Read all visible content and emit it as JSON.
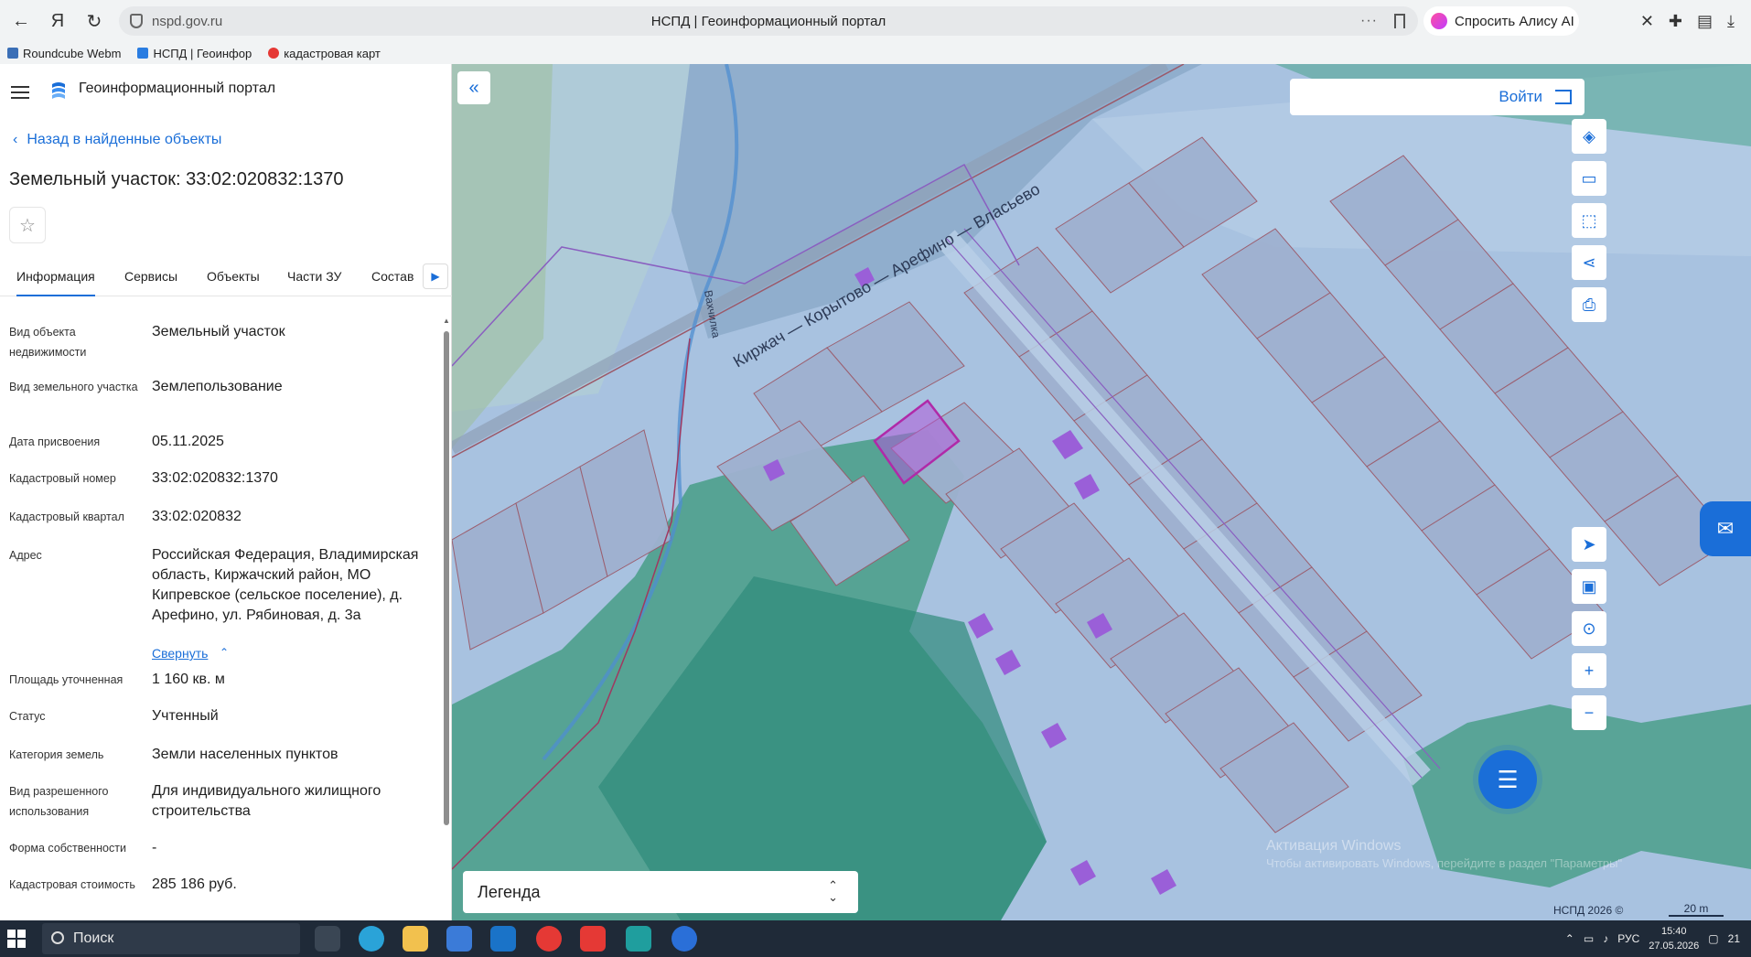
{
  "browser": {
    "url": "nspd.gov.ru",
    "tab_title": "НСПД | Геоинформационный портал",
    "alice_label": "Спросить Алису AI",
    "bookmarks": [
      {
        "label": "Roundcube Webm"
      },
      {
        "label": "НСПД | Геоинфор"
      },
      {
        "label": "кадастровая карт"
      }
    ]
  },
  "app": {
    "title": "Геоинформационный портал",
    "back_link": "Назад в найденные объекты",
    "parcel_title": "Земельный участок: 33:02:020832:1370",
    "tabs": [
      "Информация",
      "Сервисы",
      "Объекты",
      "Части ЗУ",
      "Состав"
    ],
    "collapse_label": "Свернуть",
    "fields": [
      {
        "label": "Вид объекта недвижимости",
        "value": "Земельный участок"
      },
      {
        "label": "Вид земельного участка",
        "value": "Землепользование"
      },
      {
        "label": "Дата присвоения",
        "value": "05.11.2025"
      },
      {
        "label": "Кадастровый номер",
        "value": "33:02:020832:1370"
      },
      {
        "label": "Кадастровый квартал",
        "value": "33:02:020832"
      },
      {
        "label": "Адрес",
        "value": "Российская Федерация, Владимирская область, Киржачский район, МО Кипревское (сельское поселение), д. Арефино, ул. Рябиновая, д. 3а"
      },
      {
        "label": "Площадь уточненная",
        "value": "1 160 кв. м"
      },
      {
        "label": "Статус",
        "value": "Учтенный"
      },
      {
        "label": "Категория земель",
        "value": "Земли населенных пунктов"
      },
      {
        "label": "Вид разрешенного использования",
        "value": "Для индивидуального жилищного строительства"
      },
      {
        "label": "Форма собственности",
        "value": "-"
      },
      {
        "label": "Кадастровая стоимость",
        "value": "285 186 руб."
      }
    ]
  },
  "map": {
    "login_label": "Войти",
    "legend_label": "Легенда",
    "road_label": "Киржач — Корытово — Арефино — Власьево",
    "river_label": "Вахчилка",
    "copyright": "НСПД 2026 ©",
    "scale": "20 m",
    "watermark_title": "Активация Windows",
    "watermark_sub": "Чтобы активировать Windows, перейдите в раздел \"Параметры\"",
    "colors": {
      "background": "#a8c2e0",
      "forest": "#3f9a7f",
      "selected": "#b05bd8"
    }
  },
  "taskbar": {
    "search_placeholder": "Поиск",
    "lang": "РУС",
    "time": "15:40",
    "date": "27.05.2026",
    "notif_count": "21"
  }
}
